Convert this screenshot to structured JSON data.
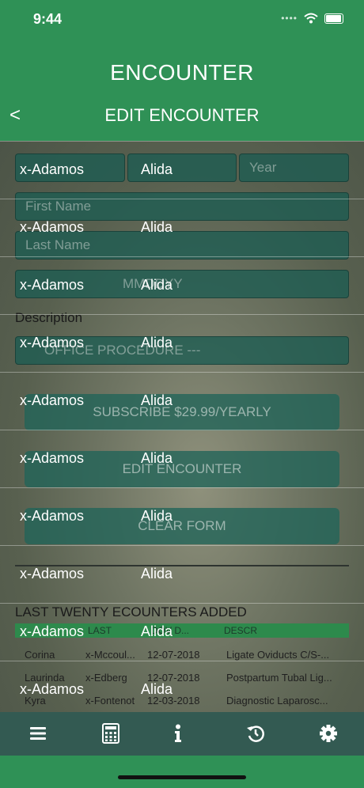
{
  "status": {
    "time": "9:44"
  },
  "header": {
    "title": "ENCOUNTER",
    "subtitle": "EDIT ENCOUNTER",
    "back_glyph": "<"
  },
  "form": {
    "field_1_placeholder": "",
    "field_2_placeholder": "",
    "year_placeholder": "Year",
    "first_name_placeholder": "First Name",
    "last_name_placeholder": "Last Name",
    "dob_placeholder": "MMDDYY",
    "description_label": "Description",
    "description_value": "OFFICE PROCEDURE ---",
    "subscribe_button": "SUBSCRIBE $29.99/YEARLY",
    "edit_button": "EDIT ENCOUNTER",
    "clear_button": "CLEAR FORM"
  },
  "recent": {
    "title": "LAST TWENTY ECOUNTERS ADDED",
    "columns": [
      "",
      "LAST",
      "DOV D...",
      "DESCR"
    ],
    "rows": [
      [
        "Corina",
        "x-Mccoul...",
        "12-07-2018",
        "Ligate Oviducts C/S-..."
      ],
      [
        "Laurinda",
        "x-Edberg",
        "12-07-2018",
        "Postpartum Tubal Lig..."
      ],
      [
        "Kyra",
        "x-Fontenot",
        "12-03-2018",
        "Diagnostic Laparosc..."
      ]
    ]
  },
  "overlay_rows": [
    {
      "last": "x-Adamos",
      "first": "Alida"
    },
    {
      "last": "x-Adamos",
      "first": "Alida"
    },
    {
      "last": "x-Adamos",
      "first": "Alida"
    },
    {
      "last": "x-Adamos",
      "first": "Alida"
    },
    {
      "last": "x-Adamos",
      "first": "Alida"
    },
    {
      "last": "x-Adamos",
      "first": "Alida"
    },
    {
      "last": "x-Adamos",
      "first": "Alida"
    },
    {
      "last": "x-Adamos",
      "first": "Alida"
    },
    {
      "last": "x-Adamos",
      "first": "Alida"
    },
    {
      "last": "x-Adamos",
      "first": "Alida"
    }
  ],
  "tabbar": {
    "items": [
      "menu-icon",
      "calculator-icon",
      "info-icon",
      "history-icon",
      "gear-icon"
    ]
  },
  "colors": {
    "header_green": "#2f9156",
    "tabbar": "#335a52",
    "field": "#1c5c52"
  }
}
